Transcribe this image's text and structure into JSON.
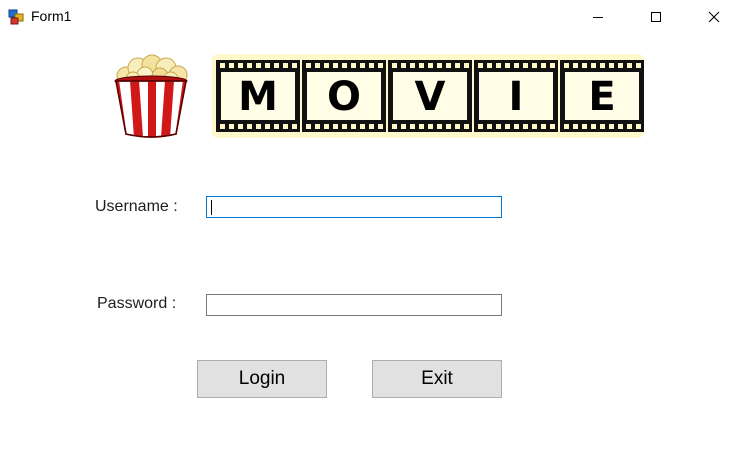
{
  "window": {
    "title": "Form1",
    "icon": "winforms-app-icon"
  },
  "banner": {
    "popcorn_icon": "popcorn-icon",
    "film_letters": [
      "M",
      "O",
      "V",
      "I",
      "E"
    ]
  },
  "form": {
    "username_label": "Username :",
    "username_value": "",
    "password_label": "Password :",
    "password_value": ""
  },
  "buttons": {
    "login_label": "Login",
    "exit_label": "Exit"
  },
  "colors": {
    "focus_border": "#0078d7",
    "button_bg": "#e1e1e1",
    "film_glow": "#fff3a0"
  }
}
